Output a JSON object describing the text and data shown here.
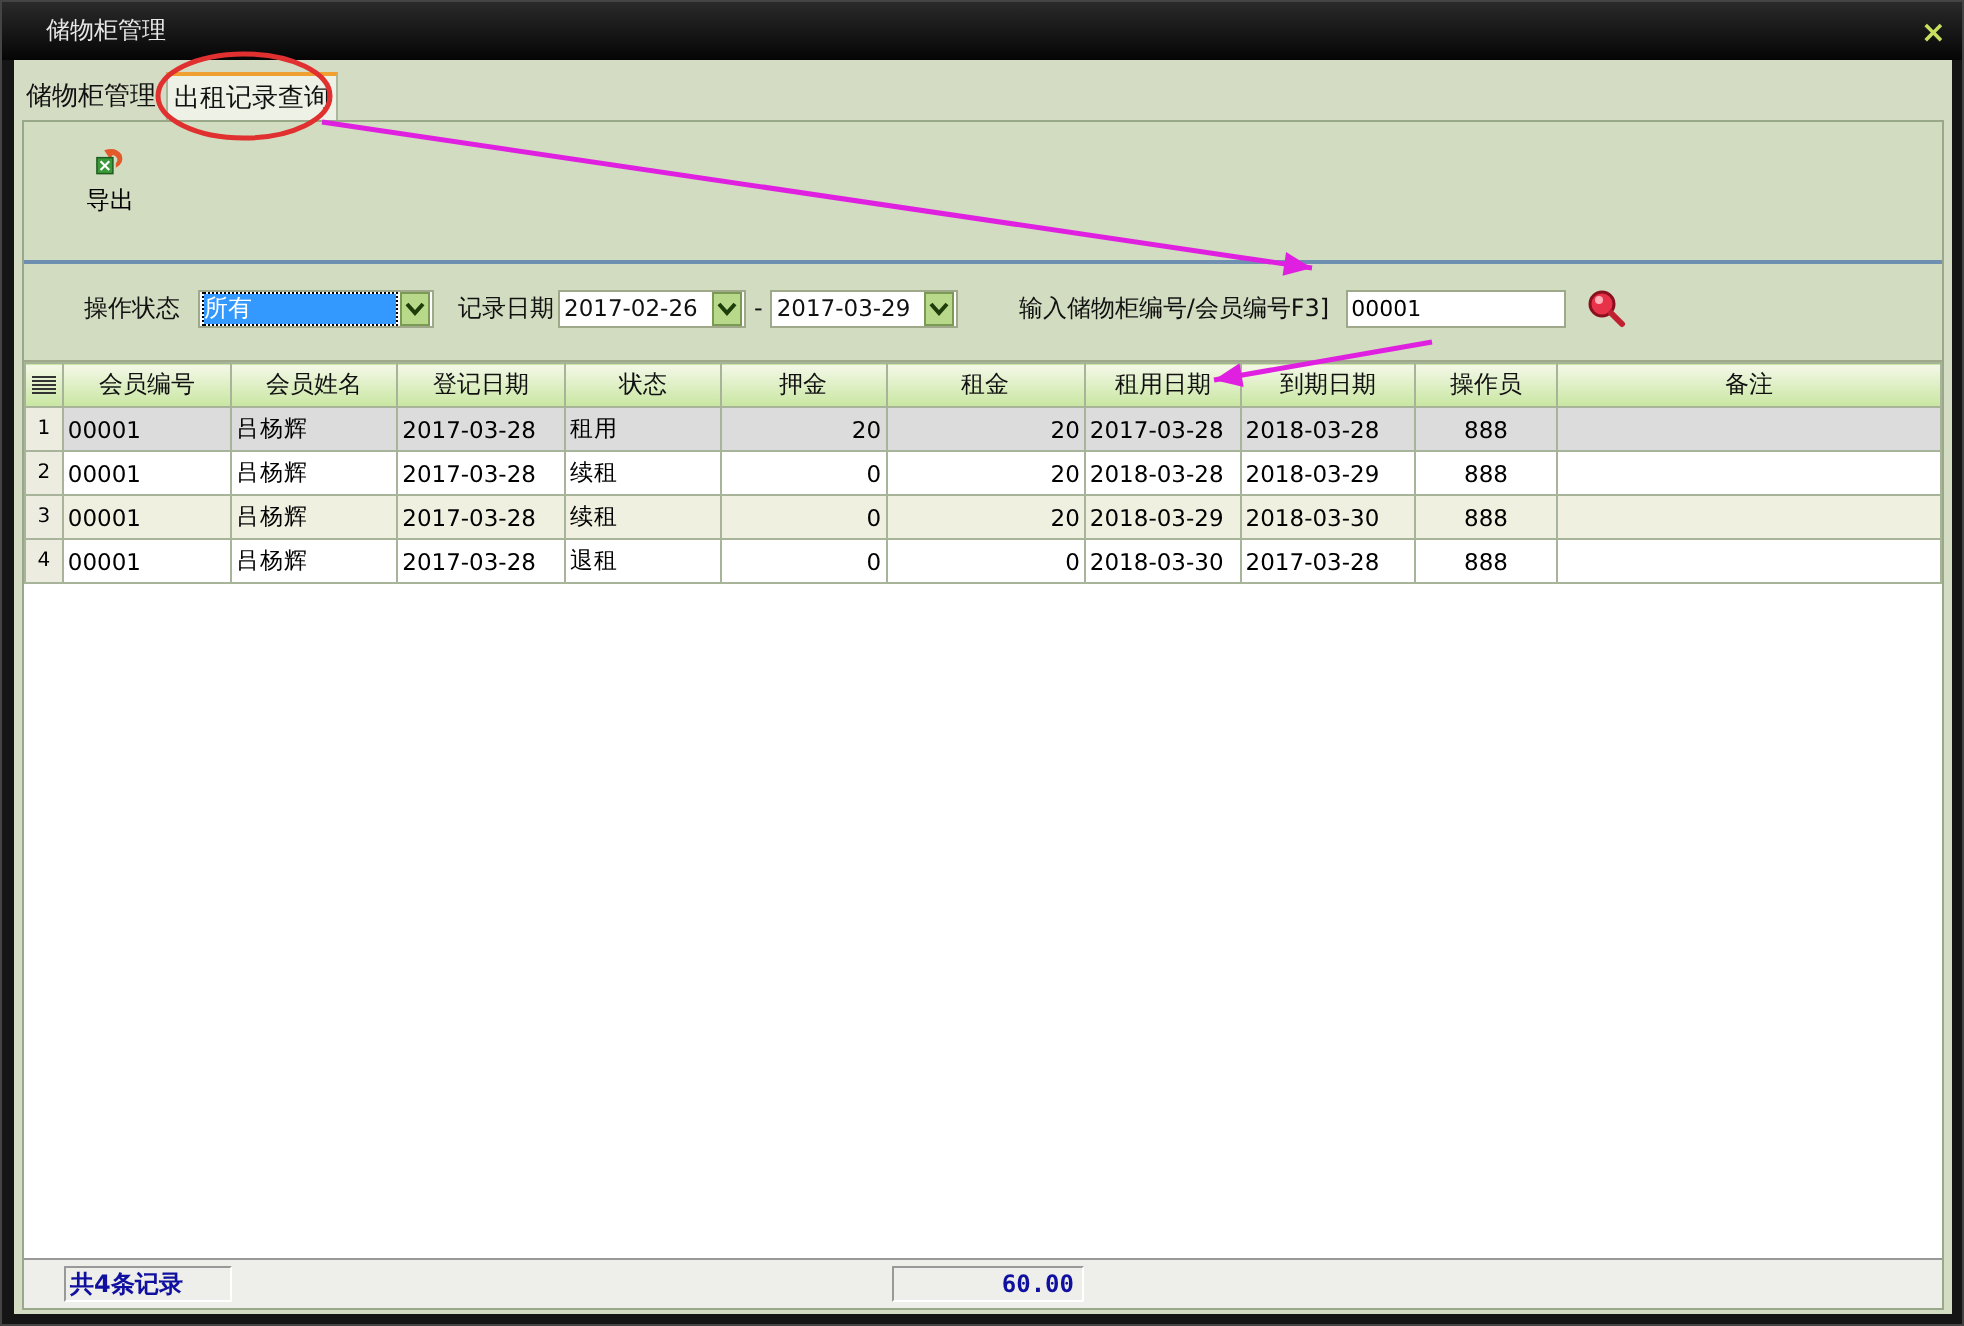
{
  "window": {
    "title": "储物柜管理",
    "close": "×"
  },
  "tabs": [
    {
      "label": "储物柜管理",
      "selected": false
    },
    {
      "label": "出租记录查询",
      "selected": true
    }
  ],
  "toolbar": [
    {
      "label": "导出"
    }
  ],
  "filters": {
    "status_label": "操作状态",
    "status_value": "所有",
    "date_label": "记录日期",
    "date_from": "2017-02-26",
    "date_sep": "-",
    "date_to": "2017-03-29",
    "search_label": "输入储物柜编号/会员编号F3]",
    "search_value": "00001"
  },
  "table": {
    "columns": [
      "会员编号",
      "会员姓名",
      "登记日期",
      "状态",
      "押金",
      "租金",
      "租用日期",
      "到期日期",
      "操作员",
      "备注"
    ],
    "rows": [
      {
        "number": "1",
        "selected": true,
        "cells": [
          "00001",
          "吕杨辉",
          "2017-03-28",
          "租用",
          "20",
          "20",
          "2017-03-28",
          "2018-03-28",
          "888",
          ""
        ]
      },
      {
        "number": "2",
        "selected": false,
        "cells": [
          "00001",
          "吕杨辉",
          "2017-03-28",
          "续租",
          "0",
          "20",
          "2018-03-28",
          "2018-03-29",
          "888",
          ""
        ]
      },
      {
        "number": "3",
        "selected": false,
        "cells": [
          "00001",
          "吕杨辉",
          "2017-03-28",
          "续租",
          "0",
          "20",
          "2018-03-29",
          "2018-03-30",
          "888",
          ""
        ]
      },
      {
        "number": "4",
        "selected": false,
        "cells": [
          "00001",
          "吕杨辉",
          "2017-03-28",
          "退租",
          "0",
          "0",
          "2018-03-30",
          "2017-03-28",
          "888",
          ""
        ]
      }
    ]
  },
  "status_bar": {
    "count": "共4条记录",
    "total": "60.00"
  },
  "annotations": [
    {
      "kind": "ellipse"
    },
    {
      "kind": "arrow"
    },
    {
      "kind": "arrow"
    }
  ]
}
